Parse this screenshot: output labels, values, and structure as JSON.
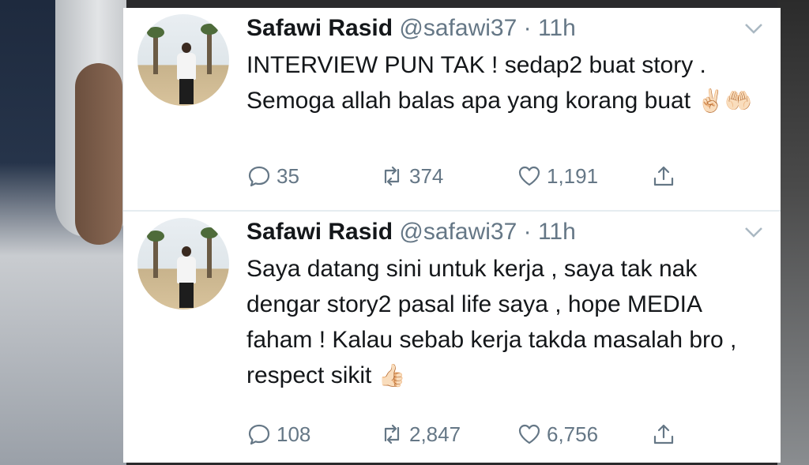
{
  "tweets": [
    {
      "author_name": "Safawi Rasid",
      "handle": "@safawi37",
      "time": "11h",
      "text": "INTERVIEW PUN TAK ! sedap2 buat story . Semoga allah balas apa yang korang buat",
      "emoji": "✌🏻🤲🏻",
      "replies": "35",
      "retweets": "374",
      "likes": "1,191"
    },
    {
      "author_name": "Safawi Rasid",
      "handle": "@safawi37",
      "time": "11h",
      "text": "Saya datang sini untuk kerja , saya tak nak dengar story2 pasal life saya , hope MEDIA faham ! Kalau sebab kerja takda masalah bro , respect sikit",
      "emoji": "👍🏻",
      "replies": "108",
      "retweets": "2,847",
      "likes": "6,756"
    }
  ],
  "icons": {
    "reply": "reply-icon",
    "retweet": "retweet-icon",
    "like": "heart-icon",
    "share": "share-icon",
    "caret": "chevron-down-icon"
  },
  "colors": {
    "text_primary": "#14171a",
    "text_secondary": "#657786",
    "divider": "#e6ecf0"
  }
}
